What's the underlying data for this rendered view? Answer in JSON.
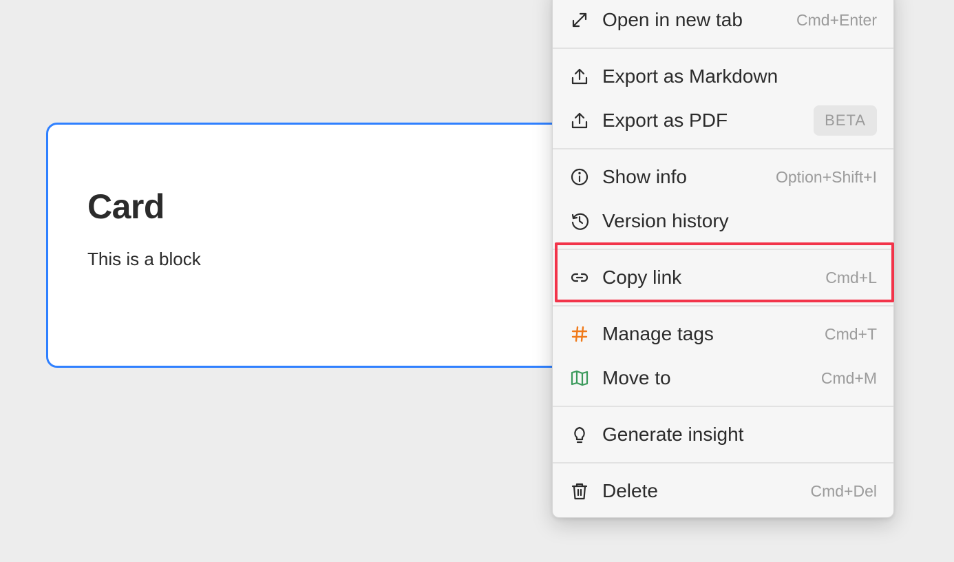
{
  "card": {
    "title": "Card",
    "body": "This is a block"
  },
  "menu": {
    "items": [
      {
        "label": "Open in new tab",
        "shortcut": "Cmd+Enter",
        "icon": "expand-icon"
      },
      {
        "label": "Export as Markdown",
        "shortcut": "",
        "icon": "upload-icon"
      },
      {
        "label": "Export as PDF",
        "badge": "BETA",
        "icon": "upload-icon"
      },
      {
        "label": "Show info",
        "shortcut": "Option+Shift+I",
        "icon": "info-icon"
      },
      {
        "label": "Version history",
        "shortcut": "",
        "icon": "history-icon"
      },
      {
        "label": "Copy link",
        "shortcut": "Cmd+L",
        "icon": "link-icon"
      },
      {
        "label": "Manage tags",
        "shortcut": "Cmd+T",
        "icon": "hashtag-icon"
      },
      {
        "label": "Move to",
        "shortcut": "Cmd+M",
        "icon": "map-icon"
      },
      {
        "label": "Generate insight",
        "shortcut": "",
        "icon": "lightbulb-icon"
      },
      {
        "label": "Delete",
        "shortcut": "Cmd+Del",
        "icon": "trash-icon"
      }
    ]
  },
  "colors": {
    "accent_blue": "#2f80ff",
    "highlight_red": "#f2344a",
    "tag_orange": "#f07a1a",
    "map_green": "#3a9a5b"
  }
}
